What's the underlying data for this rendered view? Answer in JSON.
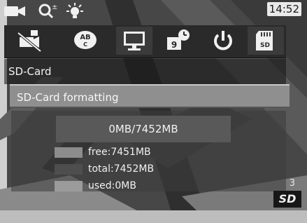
{
  "status_bar": {
    "time": "14:52",
    "icons": [
      "video-camera-icon",
      "zoom-icon",
      "brightness-icon"
    ]
  },
  "menu": {
    "items": [
      {
        "name": "camera-off-icon"
      },
      {
        "name": "ab-language-icon"
      },
      {
        "name": "monitor-icon"
      },
      {
        "name": "date-time-icon",
        "glyph": "9"
      },
      {
        "name": "power-icon"
      },
      {
        "name": "sd-card-icon",
        "glyph": "SD"
      }
    ]
  },
  "panel": {
    "title": "SD-Card",
    "format_button": "SD-Card formatting",
    "capacity": "0MB/7452MB",
    "legend": [
      {
        "label": "free:7451MB",
        "color": "#8c8c8c"
      },
      {
        "label": "total:7452MB",
        "color": "#4e4e4e"
      },
      {
        "label": "used:0MB",
        "color": "#9b9b9b"
      }
    ]
  },
  "side_label": "3",
  "badge": "SD"
}
